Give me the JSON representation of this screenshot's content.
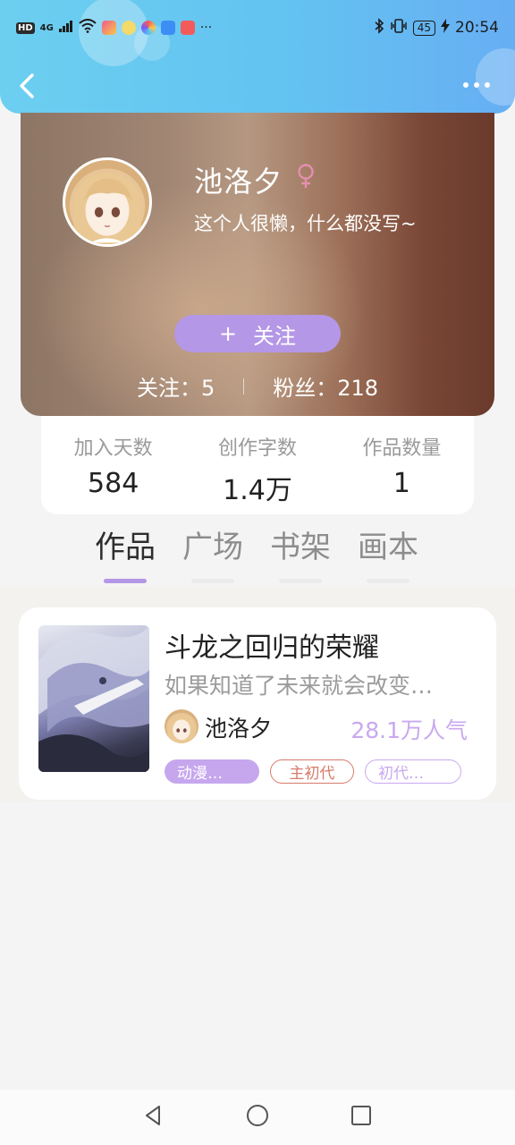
{
  "status_bar": {
    "network_tag": "HD",
    "network_type": "4G",
    "overflow": "···",
    "battery": "45",
    "time": "20:54"
  },
  "colors": {
    "accent_purple": "#b497e6",
    "header_blue": "#63c3f1",
    "female_pink": "#e48fae",
    "popularity_purple": "#c8a8ef",
    "tag_red": "#d77a6b"
  },
  "nav": {
    "back_icon": "chevron-left-icon",
    "more_icon": "more-dots-icon"
  },
  "profile": {
    "name": "池洛夕",
    "gender_symbol": "♀",
    "bio": "这个人很懒，什么都没写~",
    "follow_button": {
      "plus": "+",
      "label": "关注"
    },
    "following": {
      "label": "关注：",
      "value": "5"
    },
    "fans": {
      "label": "粉丝：",
      "value": "218"
    }
  },
  "summary": [
    {
      "label": "加入天数",
      "value": "584"
    },
    {
      "label": "创作字数",
      "value": "1.4万"
    },
    {
      "label": "作品数量",
      "value": "1"
    }
  ],
  "tabs": [
    {
      "label": "作品",
      "active": true
    },
    {
      "label": "广场",
      "active": false
    },
    {
      "label": "书架",
      "active": false
    },
    {
      "label": "画本",
      "active": false
    }
  ],
  "works": [
    {
      "title": "斗龙之回归的荣耀",
      "description": "如果知道了未来就会改变…",
      "author": "池洛夕",
      "popularity": "28.1万人气",
      "tags": [
        "动漫…",
        "主初代",
        "初代…"
      ]
    }
  ],
  "system_nav": {
    "back": "triangle-back-icon",
    "home": "circle-home-icon",
    "recents": "square-recents-icon"
  }
}
